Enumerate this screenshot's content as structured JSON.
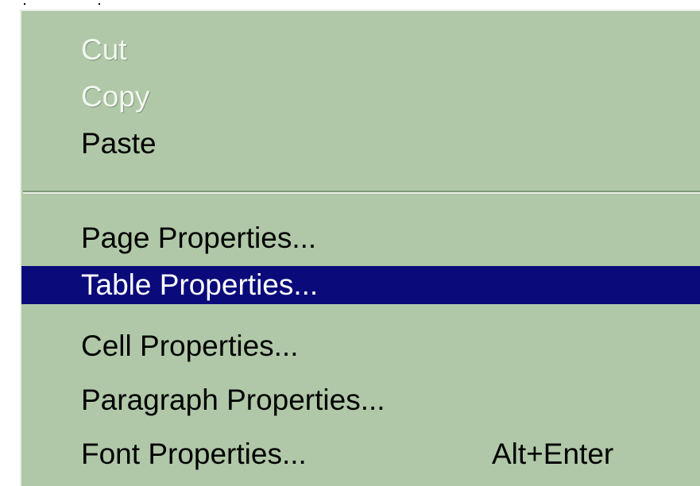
{
  "context_menu": {
    "items": [
      {
        "label": "Cut",
        "enabled": false
      },
      {
        "label": "Copy",
        "enabled": false
      },
      {
        "label": "Paste",
        "enabled": true
      },
      {
        "label": "Page Properties...",
        "enabled": true
      },
      {
        "label": "Table Properties...",
        "enabled": true,
        "highlighted": true
      },
      {
        "label": "Cell Properties...",
        "enabled": true
      },
      {
        "label": "Paragraph Properties...",
        "enabled": true
      },
      {
        "label": "Font Properties...",
        "enabled": true,
        "shortcut": "Alt+Enter"
      }
    ]
  },
  "colors": {
    "menu_background": "#b0c8a8",
    "highlight_background": "#0a0a7a",
    "highlight_text": "#ffffff",
    "disabled_text": "#f2f6f0",
    "separator_shadow": "#7e9878"
  }
}
